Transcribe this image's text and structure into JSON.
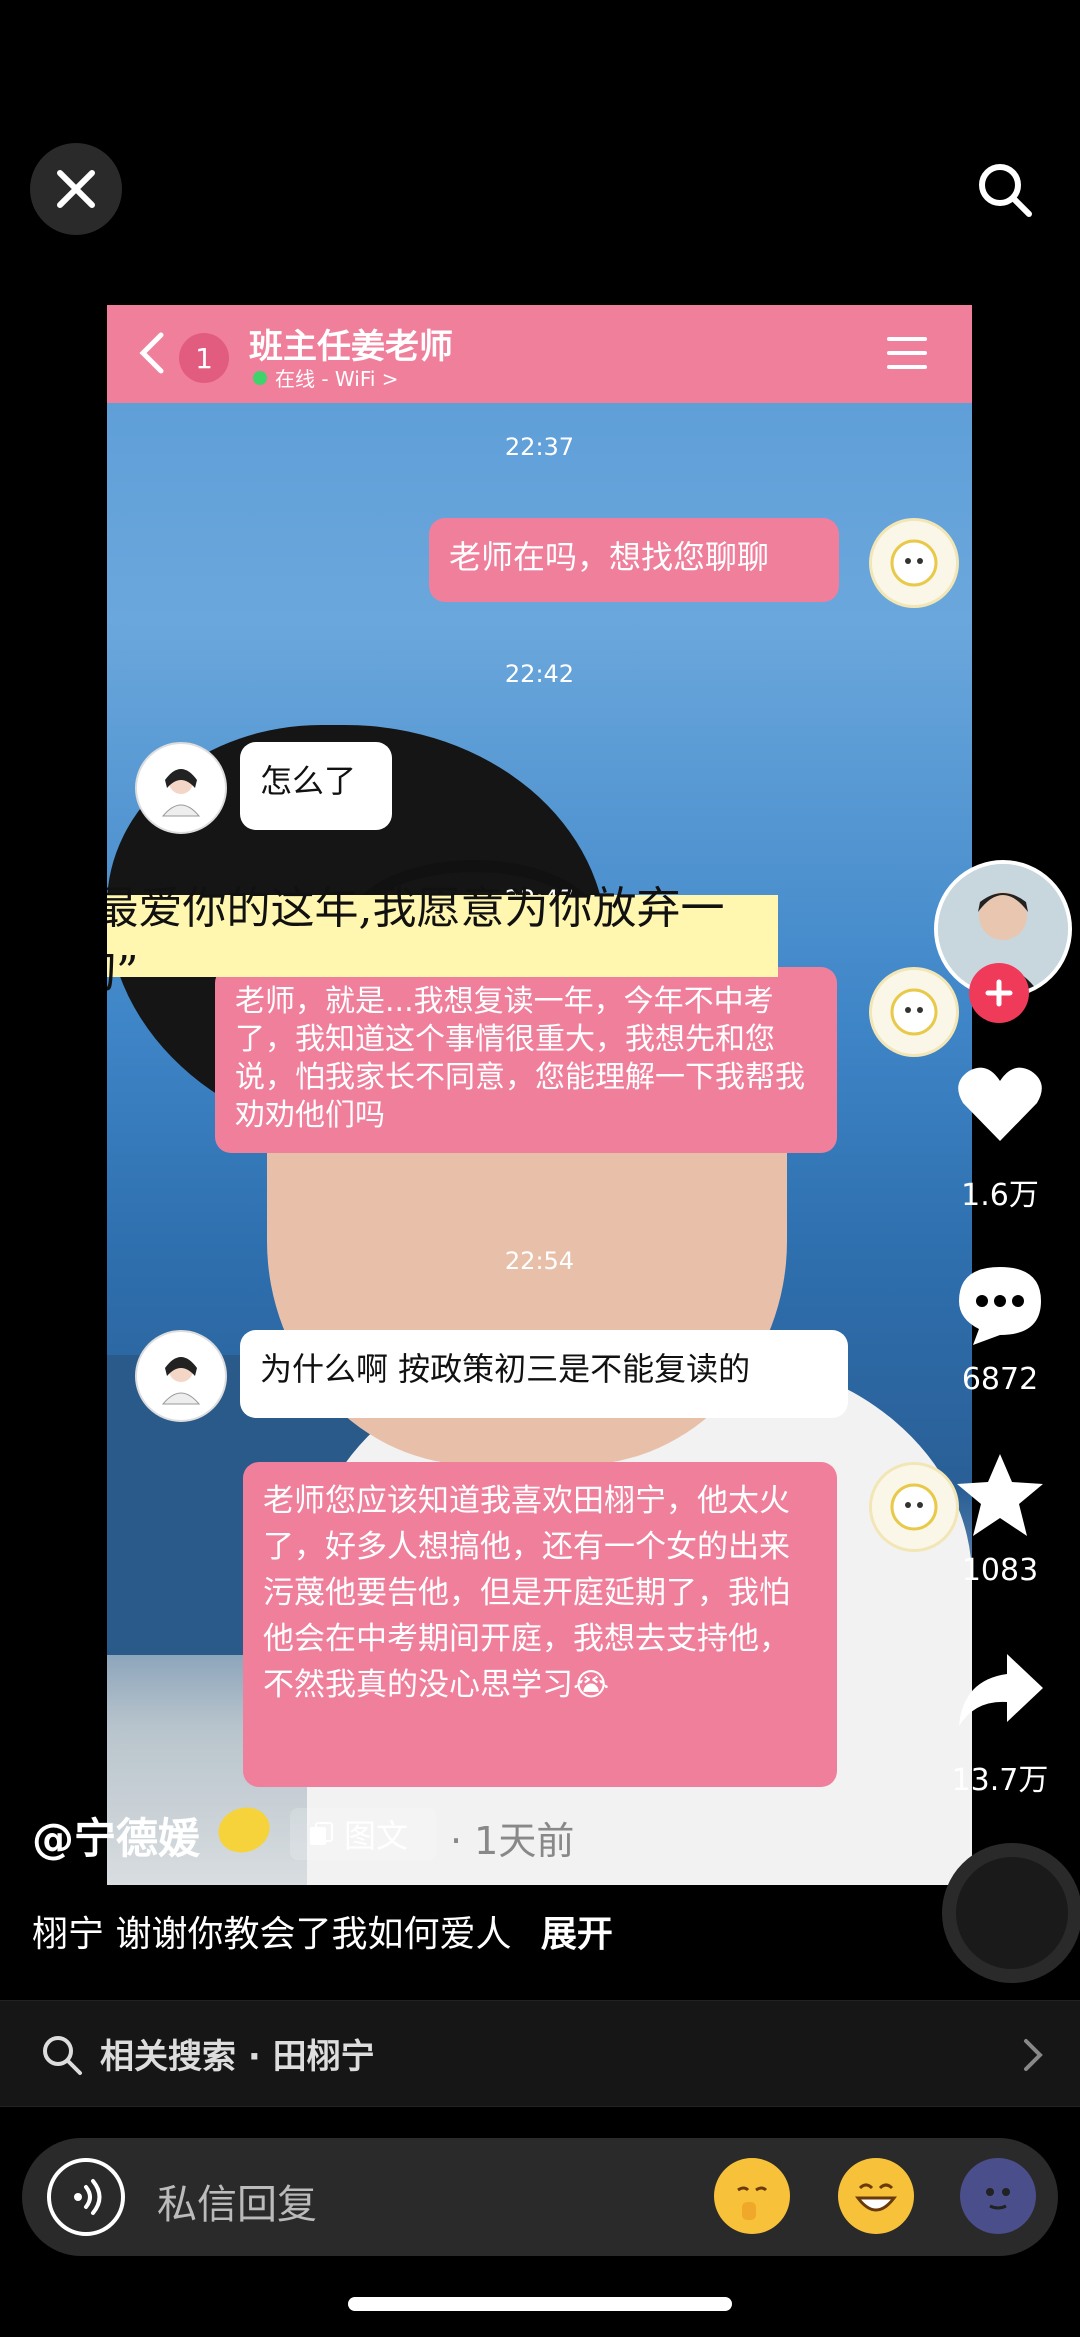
{
  "header": {
    "search_icon": "search-icon",
    "close_icon": "close-icon"
  },
  "chat": {
    "title": "班主任姜老师",
    "unread": "1",
    "status": "在线 - WiFi >",
    "messages": [
      {
        "time": "22:37",
        "side": "right",
        "text": "老师在吗，想找您聊聊"
      },
      {
        "time": "22:42",
        "side": "left",
        "text": "怎么了"
      },
      {
        "time": "22:47",
        "side": "right",
        "text": "老师，就是...我想复读一年，今年不中考了，我知道这个事情很重大，我想先和您说，怕我家长不同意，您能理解一下我帮我劝劝他们吗"
      },
      {
        "time": "22:54",
        "side": "left",
        "text": "为什么啊 按政策初三是不能复读的"
      },
      {
        "time": "",
        "side": "right",
        "text": "老师您应该知道我喜欢田栩宁，他太火了，好多人想搞他，还有一个女的出来污蔑他要告他，但是开庭延期了，我怕他会在中考期间开庭，我想去支持他，不然我真的没心思学习😭"
      }
    ]
  },
  "overlay_caption": "“最爱你的这年,我愿意为你放弃一切”",
  "sidebar": {
    "likes": "1.6万",
    "comments": "6872",
    "favorites": "1083",
    "shares": "13.7万"
  },
  "post": {
    "username": "@宁德媛",
    "tag": "图文",
    "time_ago": "· 1天前",
    "description": "栩宁 谢谢你教会了我如何爱人",
    "expand": "展开"
  },
  "related": {
    "label": "相关搜索 · 田栩宁"
  },
  "reply": {
    "placeholder": "私信回复"
  },
  "colors": {
    "accent_pink": "#f07f9c",
    "follow_red": "#f03a5a"
  }
}
